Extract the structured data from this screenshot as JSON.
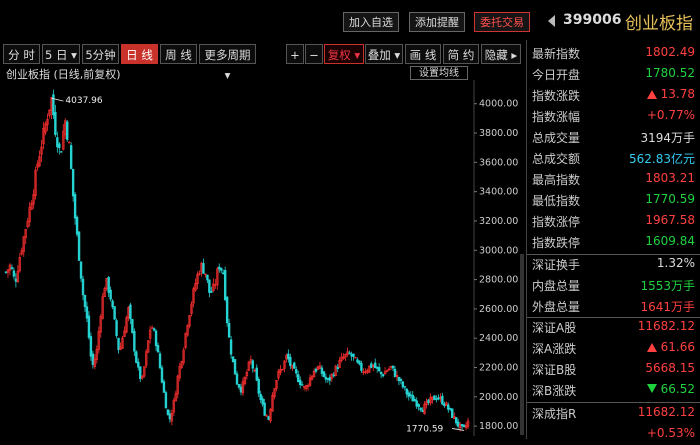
{
  "header": {
    "buttons": [
      "加入自选",
      "添加提醒",
      "委托交易"
    ],
    "code": "399006",
    "name": "创业板指"
  },
  "toolbar": {
    "items": [
      "分 时",
      "5 日 ▾",
      "5分钟",
      "日 线",
      "周 线",
      "更多周期 ▾",
      "+",
      "−",
      "复权 ▾",
      "叠加 ▾",
      "画 线",
      "简 约",
      "隐藏 ▸"
    ],
    "active": "日 线"
  },
  "chart": {
    "title": "创业板指 (日线,前复权)",
    "indicator_button": "设置均线",
    "annotation_high": "4037.96",
    "annotation_low": "1770.59"
  },
  "chart_data": {
    "type": "candlestick",
    "title": "创业板指 (日线,前复权)",
    "y_ticks": [
      4000.0,
      3800.0,
      3600.0,
      3400.0,
      3200.0,
      3000.0,
      2800.0,
      2600.0,
      2400.0,
      2200.0,
      2000.0,
      1800.0
    ],
    "y_tick_labels": [
      "4000.00",
      "3800.00",
      "3600.00",
      "3400.00",
      "3200.00",
      "3000.00",
      "2800.00",
      "2600.00",
      "2400.00",
      "2200.00",
      "2000.00",
      "1800.00"
    ],
    "ylim": [
      1760,
      4080
    ],
    "max_point": 4037.96,
    "min_point": 1770.59,
    "series_close": [
      2850,
      2900,
      2780,
      2950,
      3100,
      3250,
      3400,
      3600,
      3750,
      3900,
      4037.96,
      3800,
      3650,
      3900,
      3700,
      3300,
      3000,
      2700,
      2500,
      2200,
      2300,
      2600,
      2800,
      2700,
      2500,
      2300,
      2450,
      2600,
      2400,
      2200,
      2100,
      2300,
      2500,
      2400,
      2200,
      2000,
      1830,
      1950,
      2150,
      2300,
      2500,
      2650,
      2800,
      2900,
      2850,
      2700,
      2750,
      2900,
      2850,
      2450,
      2250,
      2100,
      2050,
      2150,
      2250,
      2150,
      2000,
      1900,
      1850,
      2050,
      2150,
      2200,
      2280,
      2200,
      2150,
      2100,
      2050,
      2120,
      2180,
      2200,
      2150,
      2100,
      2150,
      2200,
      2250,
      2280,
      2290,
      2250,
      2200,
      2180,
      2200,
      2220,
      2180,
      2150,
      2180,
      2200,
      2150,
      2100,
      2050,
      2000,
      1980,
      1950,
      1920,
      1950,
      1980,
      2000,
      1980,
      1950,
      1900,
      1850,
      1800,
      1770.59,
      1830
    ]
  },
  "panel": {
    "rows1": [
      {
        "label": "最新指数",
        "value": "1802.49",
        "color": "red"
      },
      {
        "label": "今日开盘",
        "value": "1780.52",
        "color": "green"
      },
      {
        "label": "指数涨跌",
        "value": "13.78",
        "color": "red",
        "arrow": "up"
      },
      {
        "label": "指数涨幅",
        "value": "+0.77%",
        "color": "red"
      },
      {
        "label": "总成交量",
        "value": "3194万手",
        "color": "white"
      },
      {
        "label": "总成交额",
        "value": "562.83亿元",
        "color": "cyan"
      },
      {
        "label": "最高指数",
        "value": "1803.21",
        "color": "red"
      },
      {
        "label": "最低指数",
        "value": "1770.59",
        "color": "green"
      },
      {
        "label": "指数涨停",
        "value": "1967.58",
        "color": "red"
      },
      {
        "label": "指数跌停",
        "value": "1609.84",
        "color": "green"
      }
    ],
    "rows2": [
      {
        "label": "深证换手",
        "value": "1.32%",
        "color": "white"
      },
      {
        "label": "内盘总量",
        "value": "1553万手",
        "color": "green"
      },
      {
        "label": "外盘总量",
        "value": "1641万手",
        "color": "red"
      }
    ],
    "rows3": [
      {
        "label": "深证A股",
        "value": "11682.12",
        "color": "red"
      },
      {
        "label": "深A涨跌",
        "value": "61.66",
        "color": "red",
        "arrow": "up"
      },
      {
        "label": "深证B股",
        "value": "5668.15",
        "color": "red"
      },
      {
        "label": "深B涨跌",
        "value": "66.52",
        "color": "green",
        "arrow": "down"
      }
    ],
    "rows4": [
      {
        "label": "深成指R",
        "value": "11682.12",
        "color": "red"
      },
      {
        "label": "",
        "value": "+0.53%",
        "color": "red"
      }
    ]
  }
}
